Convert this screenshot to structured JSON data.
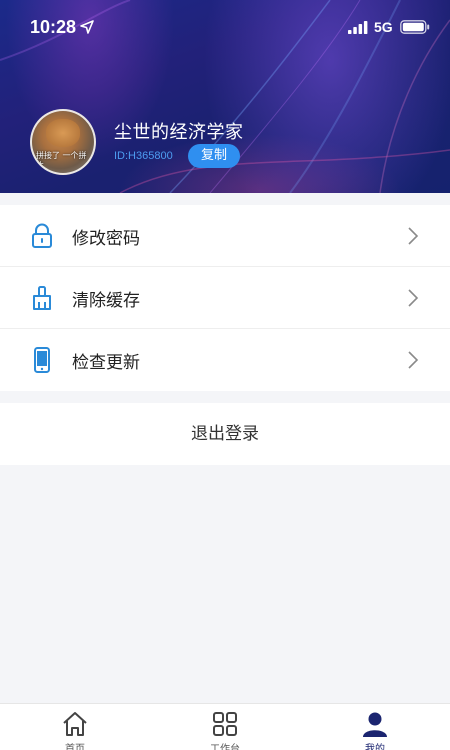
{
  "status_bar": {
    "time": "10:28",
    "network": "5G",
    "icons": [
      "location-arrow-icon",
      "signal-icon",
      "battery-icon"
    ]
  },
  "profile": {
    "username": "尘世的经济学家",
    "user_id": "ID:H365800",
    "copy_label": "复制",
    "avatar_caption": "拼接了 一个拼片"
  },
  "menu": {
    "items": [
      {
        "label": "修改密码",
        "icon": "lock-icon"
      },
      {
        "label": "清除缓存",
        "icon": "brush-icon"
      },
      {
        "label": "检查更新",
        "icon": "phone-icon"
      }
    ]
  },
  "logout": {
    "label": "退出登录"
  },
  "tabbar": {
    "items": [
      {
        "label": "首页",
        "icon": "home-icon"
      },
      {
        "label": "工作台",
        "icon": "grid-icon"
      },
      {
        "label": "我的",
        "icon": "user-icon",
        "active": true
      }
    ]
  },
  "colors": {
    "header_bg": "#1b2a8a",
    "accent": "#2f8ff0",
    "id_text": "#4d9cf0",
    "icon_blue": "#2a8ad8",
    "tab_active": "#1b2570"
  }
}
